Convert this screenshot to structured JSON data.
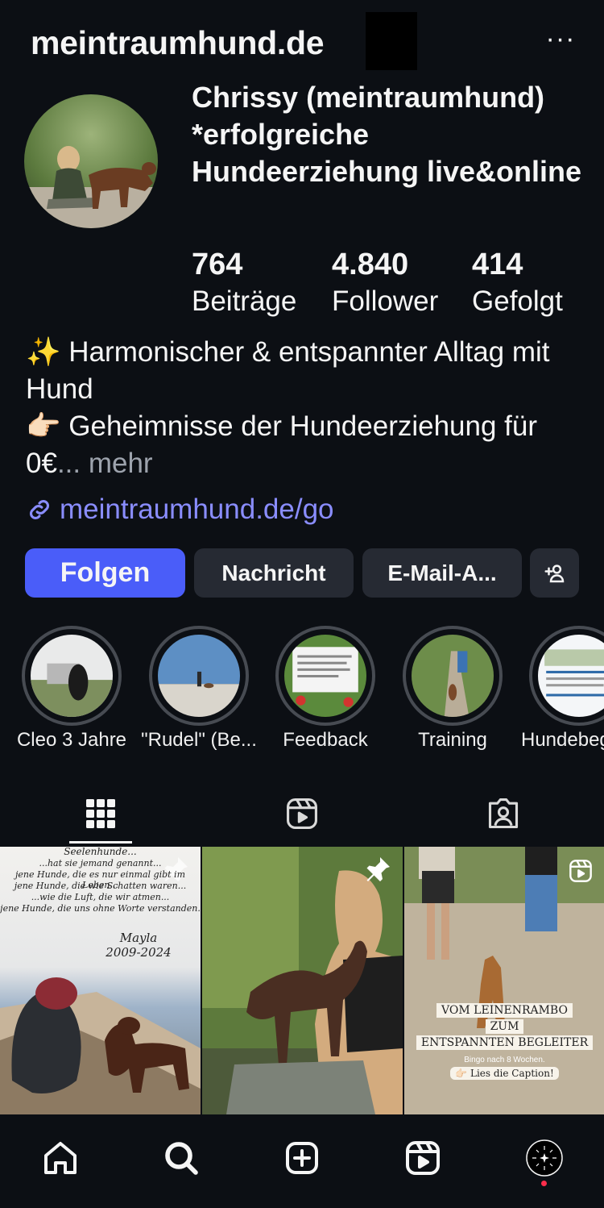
{
  "profile": {
    "username": "meintraumhund.de",
    "full_name": "Chrissy (meintraumhund) *erfolgreiche Hundeerziehung live&online",
    "stats": [
      {
        "value": "764",
        "label": "Beiträge"
      },
      {
        "value": "4.840",
        "label": "Follower"
      },
      {
        "value": "414",
        "label": "Gefolgt"
      }
    ],
    "bio_line1": "✨ Harmonischer & entspannter Alltag mit Hund",
    "bio_line2": "👉🏻 Geheimnisse der Hundeerziehung für 0€",
    "bio_more": "... mehr",
    "link": "meintraumhund.de/go"
  },
  "actions": {
    "follow": "Folgen",
    "message": "Nachricht",
    "email": "E-Mail-A...",
    "add_user_icon": "add-person-icon"
  },
  "highlights": [
    {
      "label": "Cleo 3 Jahre"
    },
    {
      "label": "\"Rudel\" (Be..."
    },
    {
      "label": "Feedback"
    },
    {
      "label": "Training"
    },
    {
      "label": "Hundebeg"
    }
  ],
  "tabs": [
    "grid-icon",
    "reels-icon",
    "tagged-icon"
  ],
  "posts": [
    {
      "poem_title": "Seelenhunde...",
      "poem": [
        "...hat sie jemand genannt...",
        "jene Hunde, die es nur einmal gibt im Leben...",
        "jene Hunde, die wie Schatten waren...",
        "...wie die Luft, die wir atmen...",
        "jene Hunde, die uns ohne Worte verstanden."
      ],
      "name": "Mayla",
      "years": "2009-2024",
      "pinned": true
    },
    {
      "pinned": true
    },
    {
      "reel": true,
      "overlay": [
        "VOM LEINENRAMBO",
        "ZUM",
        "ENTSPANNTEN BEGLEITER"
      ],
      "sub1": "Bingo nach 8 Wochen.",
      "sub2": "👉🏻 Lies die Caption!"
    }
  ],
  "colors": {
    "background": "#0c0f14",
    "follow": "#4a5df9",
    "link": "#8a8dff",
    "button": "#262a33"
  }
}
